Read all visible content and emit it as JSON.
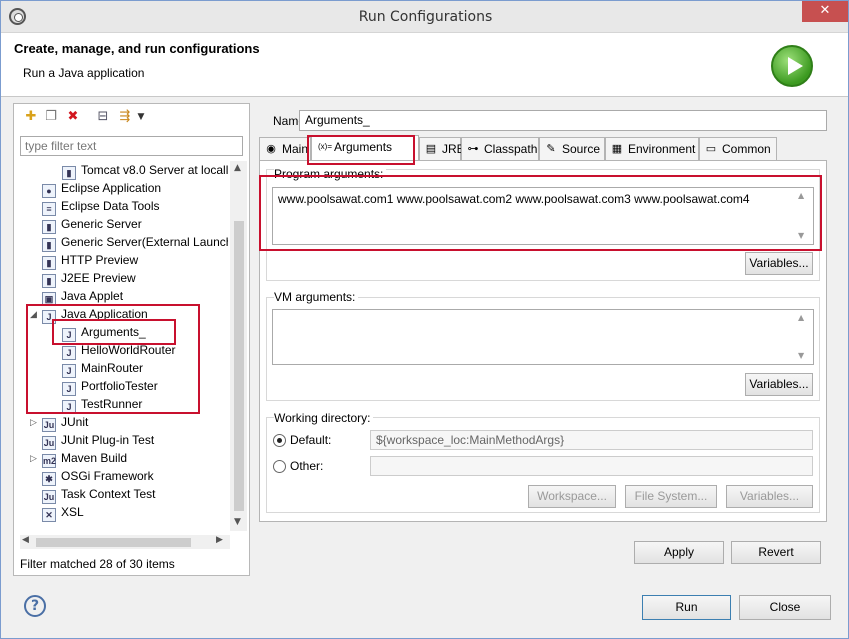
{
  "window": {
    "title": "Run Configurations",
    "close_glyph": "✕"
  },
  "header": {
    "title": "Create, manage, and run configurations",
    "subtitle": "Run a Java application"
  },
  "left": {
    "toolbar_icons": [
      "new-configuration-icon",
      "duplicate-icon",
      "delete-icon",
      "collapse-all-icon",
      "filter-icon",
      "dropdown-arrow-icon"
    ],
    "filter_placeholder": "type filter text",
    "tree": [
      {
        "label": "Tomcat v8.0 Server at locall",
        "icon": "server-icon",
        "glyph": "▮",
        "indent": 1
      },
      {
        "label": "Eclipse Application",
        "icon": "eclipse-icon",
        "glyph": "●",
        "indent": 0
      },
      {
        "label": "Eclipse Data Tools",
        "icon": "database-icon",
        "glyph": "≡",
        "indent": 0
      },
      {
        "label": "Generic Server",
        "icon": "server-icon",
        "glyph": "▮",
        "indent": 0
      },
      {
        "label": "Generic Server(External Launch)",
        "icon": "server-icon",
        "glyph": "▮",
        "indent": 0
      },
      {
        "label": "HTTP Preview",
        "icon": "server-icon",
        "glyph": "▮",
        "indent": 0
      },
      {
        "label": "J2EE Preview",
        "icon": "server-icon",
        "glyph": "▮",
        "indent": 0
      },
      {
        "label": "Java Applet",
        "icon": "applet-icon",
        "glyph": "▣",
        "indent": 0
      },
      {
        "label": "Java Application",
        "icon": "java-app-icon",
        "glyph": "J",
        "indent": 0,
        "expanded": true
      },
      {
        "label": "Arguments_",
        "icon": "java-app-icon",
        "glyph": "J",
        "indent": 1,
        "selected": true
      },
      {
        "label": "HelloWorldRouter",
        "icon": "java-app-icon",
        "glyph": "J",
        "indent": 1
      },
      {
        "label": "MainRouter",
        "icon": "java-app-icon",
        "glyph": "J",
        "indent": 1
      },
      {
        "label": "PortfolioTester",
        "icon": "java-app-icon",
        "glyph": "J",
        "indent": 1
      },
      {
        "label": "TestRunner",
        "icon": "java-app-icon",
        "glyph": "J",
        "indent": 1
      },
      {
        "label": "JUnit",
        "icon": "junit-icon",
        "glyph": "Ju",
        "indent": 0,
        "collapsed": true
      },
      {
        "label": "JUnit Plug-in Test",
        "icon": "junit-icon",
        "glyph": "Ju",
        "indent": 0
      },
      {
        "label": "Maven Build",
        "icon": "maven-icon",
        "glyph": "m2",
        "indent": 0,
        "collapsed": true
      },
      {
        "label": "OSGi Framework",
        "icon": "osgi-icon",
        "glyph": "✱",
        "indent": 0
      },
      {
        "label": "Task Context Test",
        "icon": "junit-icon",
        "glyph": "Ju",
        "indent": 0
      },
      {
        "label": "XSL",
        "icon": "xsl-icon",
        "glyph": "✕",
        "indent": 0
      }
    ],
    "filter_status": "Filter matched 28 of 30 items"
  },
  "right": {
    "name_label": "Name:",
    "name_value": "Arguments_",
    "tabs": [
      {
        "label": "Main",
        "icon": "main-tab-icon",
        "glyph": "◉"
      },
      {
        "label": "Arguments",
        "icon": "arguments-tab-icon",
        "glyph": "(x)=",
        "active": true
      },
      {
        "label": "JRE",
        "icon": "jre-tab-icon",
        "glyph": "▤"
      },
      {
        "label": "Classpath",
        "icon": "classpath-tab-icon",
        "glyph": "⊶"
      },
      {
        "label": "Source",
        "icon": "source-tab-icon",
        "glyph": "✎"
      },
      {
        "label": "Environment",
        "icon": "environment-tab-icon",
        "glyph": "▦"
      },
      {
        "label": "Common",
        "icon": "common-tab-icon",
        "glyph": "▭"
      }
    ],
    "program_arguments_label": "Program arguments:",
    "program_arguments_value": "www.poolsawat.com1 www.poolsawat.com2 www.poolsawat.com3 www.poolsawat.com4",
    "variables_label": "Variables...",
    "vm_arguments_label": "VM arguments:",
    "vm_arguments_value": "",
    "working_directory_label": "Working directory:",
    "default_label": "Default:",
    "default_value": "${workspace_loc:MainMethodArgs}",
    "other_label": "Other:",
    "other_value": "",
    "workspace_label": "Workspace...",
    "filesystem_label": "File System...",
    "apply_label": "Apply",
    "revert_label": "Revert"
  },
  "footer": {
    "help_glyph": "?",
    "run_label": "Run",
    "close_label": "Close"
  }
}
